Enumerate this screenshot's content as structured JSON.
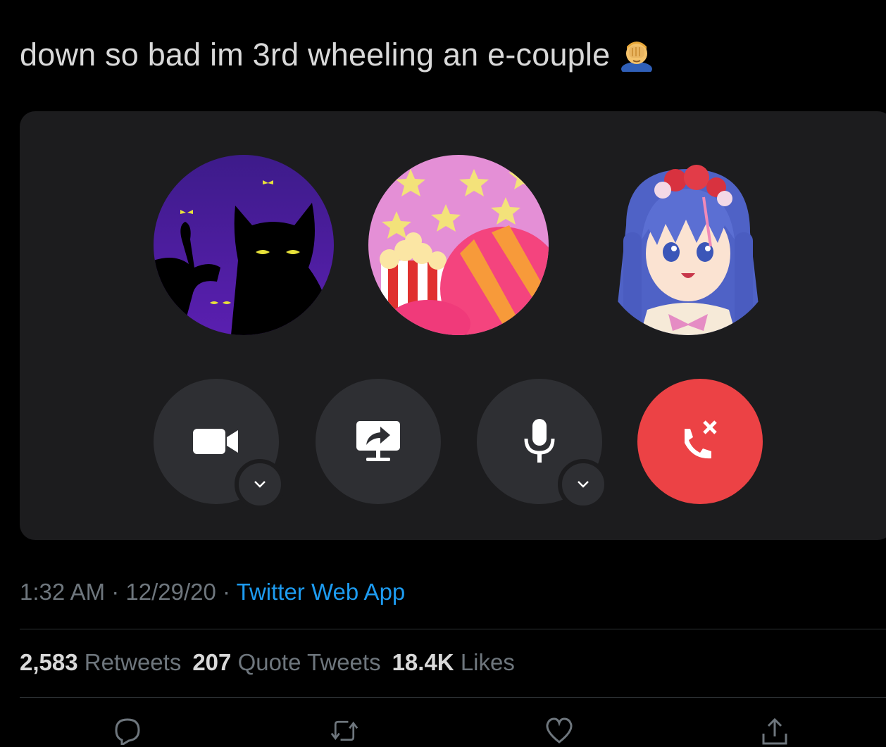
{
  "tweet": {
    "text": "down so bad im 3rd wheeling an e-couple",
    "emoji_icon": "facepalm-emoji-icon"
  },
  "call": {
    "participants": [
      {
        "avatar_icon": "black-cat-avatar-icon"
      },
      {
        "avatar_icon": "popcorn-candy-avatar-icon"
      },
      {
        "avatar_icon": "anime-girl-avatar-icon"
      }
    ],
    "controls": [
      {
        "icon": "video-camera-icon",
        "has_dropdown": true
      },
      {
        "icon": "screen-share-icon",
        "has_dropdown": false
      },
      {
        "icon": "microphone-icon",
        "has_dropdown": true
      },
      {
        "icon": "end-call-icon",
        "has_dropdown": false
      }
    ],
    "colors": {
      "card_bg": "#1c1c1e",
      "button_bg": "#2e2f33",
      "end_call": "#ec4245"
    }
  },
  "meta": {
    "time": "1:32 AM",
    "separator": " · ",
    "date": "12/29/20",
    "app": "Twitter Web App"
  },
  "stats": {
    "retweets_count": "2,583",
    "retweets_label": "Retweets",
    "quotes_count": "207",
    "quotes_label": "Quote Tweets",
    "likes_count": "18.4K",
    "likes_label": "Likes"
  },
  "actions": [
    "reply-icon",
    "retweet-icon",
    "like-icon",
    "share-icon"
  ],
  "colors": {
    "link": "#1d9bf0",
    "muted": "#6e767d",
    "text": "#d9d9d9"
  }
}
